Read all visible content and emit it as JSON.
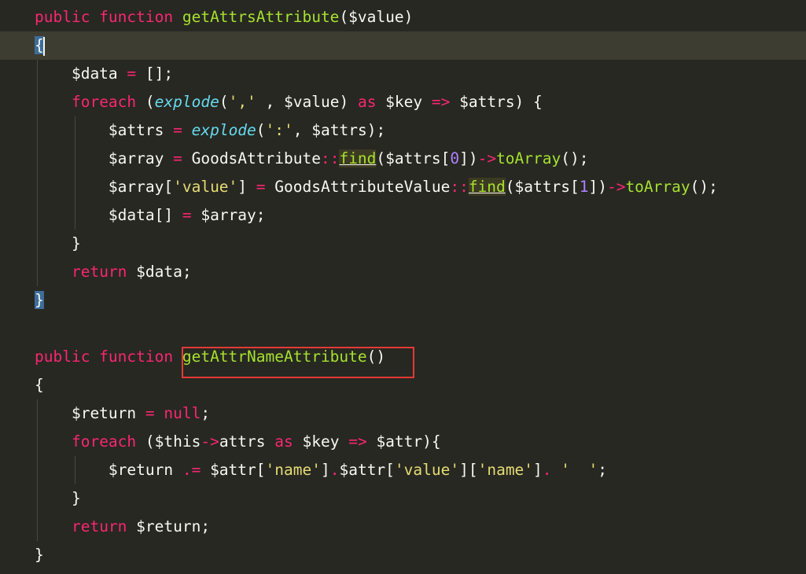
{
  "editor": {
    "theme_colors": {
      "background": "#272822",
      "current_line": "#3e3d32",
      "keyword": "#f92672",
      "string": "#e6db74",
      "function": "#a6e22e",
      "builtin": "#66d9ef",
      "number": "#ae81ff",
      "plain": "#f8f8f2",
      "annotation_box": "#e53935"
    },
    "lines": [
      [
        {
          "c": "k",
          "t": "public function "
        },
        {
          "c": "f",
          "t": "getAttrsAttribute"
        },
        {
          "c": "p",
          "t": "($value)"
        }
      ],
      [
        {
          "c": "brace-sel",
          "t": "{"
        },
        {
          "c": "caret",
          "t": ""
        }
      ],
      [
        {
          "c": "p",
          "t": "    $data "
        },
        {
          "c": "k",
          "t": "="
        },
        {
          "c": "p",
          "t": " [];"
        }
      ],
      [
        {
          "c": "p",
          "t": "    "
        },
        {
          "c": "k",
          "t": "foreach"
        },
        {
          "c": "p",
          "t": " ("
        },
        {
          "c": "b",
          "t": "explode"
        },
        {
          "c": "p",
          "t": "("
        },
        {
          "c": "s",
          "t": "','"
        },
        {
          "c": "p",
          "t": " , $value) "
        },
        {
          "c": "k",
          "t": "as"
        },
        {
          "c": "p",
          "t": " $key "
        },
        {
          "c": "k",
          "t": "=>"
        },
        {
          "c": "p",
          "t": " $attrs) {"
        }
      ],
      [
        {
          "c": "p",
          "t": "        $attrs "
        },
        {
          "c": "k",
          "t": "="
        },
        {
          "c": "p",
          "t": " "
        },
        {
          "c": "b",
          "t": "explode"
        },
        {
          "c": "p",
          "t": "("
        },
        {
          "c": "s",
          "t": "':'"
        },
        {
          "c": "p",
          "t": ", $attrs);"
        }
      ],
      [
        {
          "c": "p",
          "t": "        $array "
        },
        {
          "c": "k",
          "t": "="
        },
        {
          "c": "p",
          "t": " GoodsAttribute"
        },
        {
          "c": "k",
          "t": "::"
        },
        {
          "c": "fm",
          "t": "find"
        },
        {
          "c": "p",
          "t": "($attrs["
        },
        {
          "c": "n",
          "t": "0"
        },
        {
          "c": "p",
          "t": "])"
        },
        {
          "c": "k",
          "t": "->"
        },
        {
          "c": "f",
          "t": "toArray"
        },
        {
          "c": "p",
          "t": "();"
        }
      ],
      [
        {
          "c": "p",
          "t": "        $array["
        },
        {
          "c": "s",
          "t": "'value'"
        },
        {
          "c": "p",
          "t": "] "
        },
        {
          "c": "k",
          "t": "="
        },
        {
          "c": "p",
          "t": " GoodsAttributeValue"
        },
        {
          "c": "k",
          "t": "::"
        },
        {
          "c": "fm",
          "t": "find"
        },
        {
          "c": "p",
          "t": "($attrs["
        },
        {
          "c": "n",
          "t": "1"
        },
        {
          "c": "p",
          "t": "])"
        },
        {
          "c": "k",
          "t": "->"
        },
        {
          "c": "f",
          "t": "toArray"
        },
        {
          "c": "p",
          "t": "();"
        }
      ],
      [
        {
          "c": "p",
          "t": "        $data[] "
        },
        {
          "c": "k",
          "t": "="
        },
        {
          "c": "p",
          "t": " $array;"
        }
      ],
      [
        {
          "c": "p",
          "t": "    }"
        }
      ],
      [
        {
          "c": "p",
          "t": "    "
        },
        {
          "c": "k",
          "t": "return"
        },
        {
          "c": "p",
          "t": " $data;"
        }
      ],
      [
        {
          "c": "brace-sel",
          "t": "}"
        }
      ],
      [],
      [
        {
          "c": "k",
          "t": "public function "
        },
        {
          "c": "f",
          "t": "getAttrNameAttribute"
        },
        {
          "c": "p",
          "t": "()"
        }
      ],
      [
        {
          "c": "p",
          "t": "{"
        }
      ],
      [
        {
          "c": "p",
          "t": "    $return "
        },
        {
          "c": "k",
          "t": "="
        },
        {
          "c": "p",
          "t": " "
        },
        {
          "c": "k",
          "t": "null"
        },
        {
          "c": "p",
          "t": ";"
        }
      ],
      [
        {
          "c": "p",
          "t": "    "
        },
        {
          "c": "k",
          "t": "foreach"
        },
        {
          "c": "p",
          "t": " ($this"
        },
        {
          "c": "k",
          "t": "->"
        },
        {
          "c": "p",
          "t": "attrs "
        },
        {
          "c": "k",
          "t": "as"
        },
        {
          "c": "p",
          "t": " $key "
        },
        {
          "c": "k",
          "t": "=>"
        },
        {
          "c": "p",
          "t": " $attr){"
        }
      ],
      [
        {
          "c": "p",
          "t": "        $return "
        },
        {
          "c": "k",
          "t": ".="
        },
        {
          "c": "p",
          "t": " $attr["
        },
        {
          "c": "s",
          "t": "'name'"
        },
        {
          "c": "p",
          "t": "]"
        },
        {
          "c": "k",
          "t": "."
        },
        {
          "c": "p",
          "t": "$attr["
        },
        {
          "c": "s",
          "t": "'value'"
        },
        {
          "c": "p",
          "t": "]["
        },
        {
          "c": "s",
          "t": "'name'"
        },
        {
          "c": "p",
          "t": "]"
        },
        {
          "c": "k",
          "t": "."
        },
        {
          "c": "p",
          "t": " "
        },
        {
          "c": "s",
          "t": "'  '"
        },
        {
          "c": "p",
          "t": ";"
        }
      ],
      [
        {
          "c": "p",
          "t": "    }"
        }
      ],
      [
        {
          "c": "p",
          "t": "    "
        },
        {
          "c": "k",
          "t": "return"
        },
        {
          "c": "p",
          "t": " $return;"
        }
      ],
      [
        {
          "c": "p",
          "t": "}"
        }
      ]
    ],
    "current_line_index": 1,
    "annotated_line_index": 12
  }
}
